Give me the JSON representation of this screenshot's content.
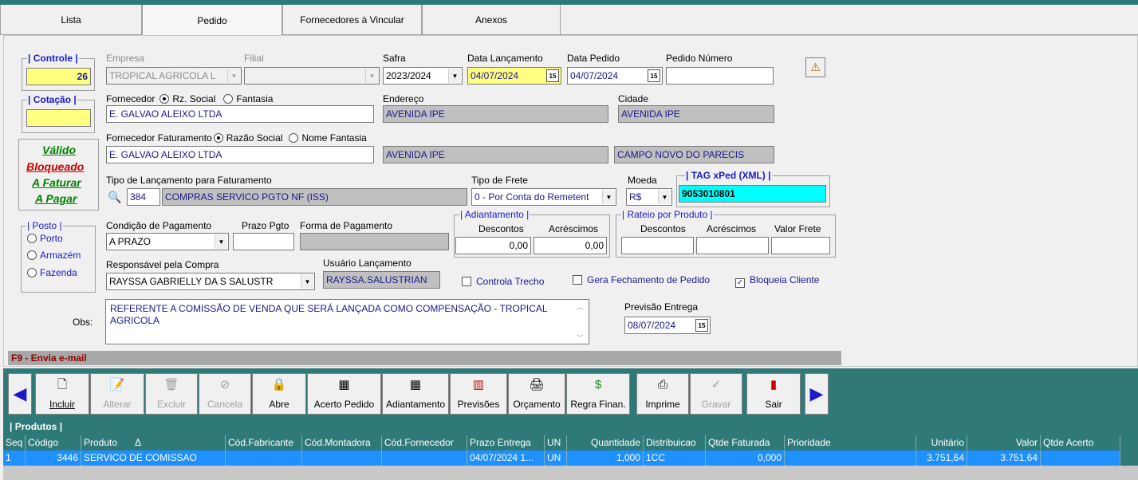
{
  "tabs": [
    "Lista",
    "Pedido",
    "Fornecedores à Vincular",
    "Anexos"
  ],
  "controle": {
    "label": "| Controle |",
    "value": "26"
  },
  "cotacao": {
    "label": "| Cotação |",
    "value": ""
  },
  "status": {
    "valido": "Válido",
    "bloqueado": "Bloqueado",
    "a_faturar": "A Faturar",
    "a_pagar": "A Pagar",
    "colors": {
      "valido": "#008000",
      "bloqueado": "#cc0000",
      "a_faturar": "#008000",
      "a_pagar": "#008000"
    }
  },
  "empresa": {
    "label": "Empresa",
    "value": "TROPICAL AGRICOLA L"
  },
  "filial": {
    "label": "Filial",
    "value": ""
  },
  "safra": {
    "label": "Safra",
    "value": "2023/2024"
  },
  "data_lancamento": {
    "label": "Data Lançamento",
    "value": "04/07/2024"
  },
  "data_pedido": {
    "label": "Data Pedido",
    "value": "04/07/2024"
  },
  "pedido_numero": {
    "label": "Pedido Número",
    "value": ""
  },
  "fornecedor": {
    "label": "Fornecedor",
    "opt1": "Rz. Social",
    "opt2": "Fantasia",
    "value": "E. GALVAO ALEIXO LTDA"
  },
  "endereco": {
    "label": "Endereço",
    "value": "AVENIDA IPE"
  },
  "cidade": {
    "label": "Cidade",
    "value": "AVENIDA IPE"
  },
  "forn_fat": {
    "label": "Fornecedor Faturamento",
    "opt1": "Razão Social",
    "opt2": "Nome Fantasia",
    "value": "E. GALVAO ALEIXO LTDA",
    "endereco": "AVENIDA IPE",
    "cidade": "CAMPO NOVO DO PARECIS"
  },
  "tipo_lanc": {
    "label": "Tipo de Lançamento para Faturamento",
    "code": "384",
    "desc": "COMPRAS SERVICO PGTO NF (ISS)"
  },
  "tipo_frete": {
    "label": "Tipo de Frete",
    "value": "0 - Por Conta do Remetent"
  },
  "moeda": {
    "label": "Moeda",
    "value": "R$"
  },
  "tag_xped": {
    "label": "| TAG xPed (XML) |",
    "value": "9053010801"
  },
  "posto": {
    "label": "| Posto |",
    "opts": [
      "Porto",
      "Armazém",
      "Fazenda"
    ]
  },
  "cond_pag": {
    "label": "Condição de Pagamento",
    "value": "A PRAZO"
  },
  "prazo_pgto": {
    "label": "Prazo Pgto",
    "value": ""
  },
  "forma_pag": {
    "label": "Forma de Pagamento",
    "value": ""
  },
  "adiantamento": {
    "label": "| Adiantamento |",
    "descontos_label": "Descontos",
    "acrescimos_label": "Acréscimos",
    "descontos": "0,00",
    "acrescimos": "0,00"
  },
  "rateio": {
    "label": "| Rateio por Produto |",
    "descontos_label": "Descontos",
    "acrescimos_label": "Acréscimos",
    "frete_label": "Valor Frete"
  },
  "responsavel": {
    "label": "Responsável pela Compra",
    "value": "RAYSSA GABRIELLY DA S SALUSTR"
  },
  "usuario": {
    "label": "Usuário Lançamento",
    "value": "RAYSSA.SALUSTRIAN"
  },
  "checks": {
    "controla_trecho": "Controla Trecho",
    "gera_fechamento": "Gera Fechamento de Pedido",
    "bloqueia_cliente": "Bloqueia Cliente"
  },
  "obs": {
    "label": "Obs:",
    "value": "REFERENTE A COMISSÃO DE VENDA QUE SERÁ LANÇADA COMO COMPENSAÇÃO - TROPICAL AGRICOLA"
  },
  "previsao": {
    "label": "Previsão Entrega",
    "value": "08/07/2024"
  },
  "statusbar": "F9 - Envia e-mail",
  "toolbar": [
    "Incluir",
    "Alterar",
    "Excluir",
    "Cancela",
    "Abre",
    "Acerto Pedido",
    "Adiantamento",
    "Previsões",
    "Orçamento",
    "Regra Finan.",
    "Imprime",
    "Gravar",
    "Sair"
  ],
  "grid": {
    "title": "| Produtos |",
    "headers": [
      "Seq",
      "Código",
      "Produto",
      "Δ",
      "Cód.Fabricante",
      "Cód.Montadora",
      "Cód.Fornecedor",
      "Prazo Entrega",
      "UN",
      "Quantidade",
      "Distribuicao",
      "Qtde Faturada",
      "Prioridade",
      "Unitário",
      "Valor",
      "Qtde Acerto"
    ],
    "row": [
      "1",
      "3446",
      "SERVICO DE COMISSAO",
      "",
      "",
      "",
      "04/07/2024 1...",
      "UN",
      "1,000",
      "1CC",
      "0,000",
      "",
      "3.751,64",
      "3.751,64",
      ""
    ]
  }
}
